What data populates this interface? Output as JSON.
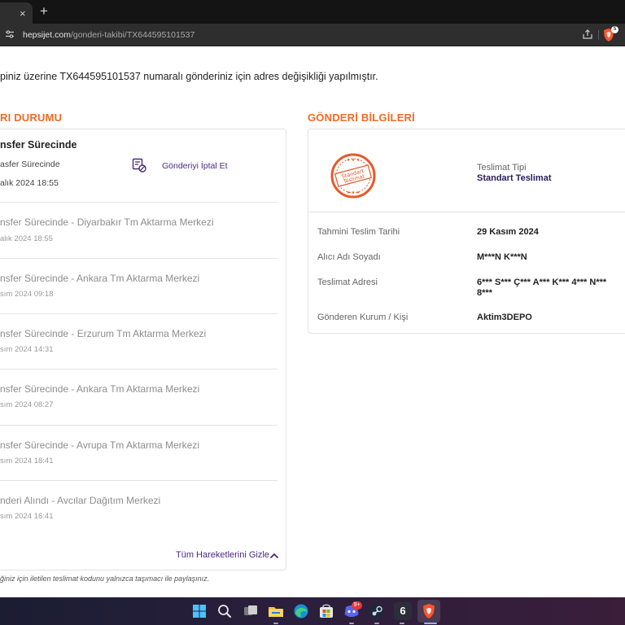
{
  "browser": {
    "tab_close": "×",
    "new_tab": "+",
    "url_host": "hepsijet.com",
    "url_path": "/gonderi-takibi/TX644595101537",
    "shield_badge": "5"
  },
  "notice": "piniz üzerine TX644595101537 numaralı gönderiniz için adres değişikliği yapılmıştır.",
  "status_section": {
    "title": "RI DURUMU",
    "current": {
      "title": "nsfer Sürecinde",
      "subtitle": "asfer Sürecinde",
      "date": "alık 2024 18:55"
    },
    "cancel_label": "Gönderiyi İptal Et",
    "events": [
      {
        "title": "nsfer Sürecinde - Diyarbakır Tm Aktarma Merkezi",
        "date": "alık 2024 18:55"
      },
      {
        "title": "nsfer Sürecinde - Ankara Tm Aktarma Merkezi",
        "date": "sım 2024 09:18"
      },
      {
        "title": "nsfer Sürecinde - Erzurum Tm Aktarma Merkezi",
        "date": "sım 2024 14:31"
      },
      {
        "title": "nsfer Sürecinde - Ankara Tm Aktarma Merkezi",
        "date": "sım 2024 08:27"
      },
      {
        "title": "nsfer Sürecinde - Avrupa Tm Aktarma Merkezi",
        "date": "sım 2024 18:41"
      },
      {
        "title": "nderi Alındı - Avcılar Dağıtım Merkezi",
        "date": "sım 2024 16:41"
      }
    ],
    "hide_label": "Tüm Hareketlerini Gizle",
    "footer_note": "ğiniz için iletilen teslimat kodunu yalnızca taşımacı ile paylaşınız."
  },
  "info_section": {
    "title": "GÖNDERİ BİLGİLERİ",
    "stamp_text": [
      "Standart",
      "Teslimat"
    ],
    "delivery_type_label": "Teslimat Tipi",
    "delivery_type_value": "Standart Teslimat",
    "rows": [
      {
        "label": "Tahmini Teslim Tarihi",
        "value": "29 Kasım 2024"
      },
      {
        "label": "Alıcı Adı Soyadı",
        "value": "M***N K***N"
      },
      {
        "label": "Teslimat Adresi",
        "value": "6*** S*** Ç*** A*** K*** 4*** N*** 8***"
      },
      {
        "label": "Gönderen Kurum / Kişi",
        "value": "Aktim3DEPO"
      }
    ]
  },
  "taskbar": {
    "discord_badge": "9+",
    "steam_count": "6"
  },
  "colors": {
    "accent_orange": "#f26a21",
    "link_purple": "#4b2a80",
    "stamp_orange": "#e35a2b"
  },
  "icons": [
    "close-icon",
    "plus-icon",
    "site-settings-icon",
    "share-icon",
    "brave-shield-icon",
    "cancel-package-icon",
    "chevron-up-icon",
    "windows-start-icon",
    "search-icon",
    "task-view-icon",
    "file-explorer-icon",
    "edge-icon",
    "store-icon",
    "discord-icon",
    "steam-icon",
    "brave-icon"
  ]
}
